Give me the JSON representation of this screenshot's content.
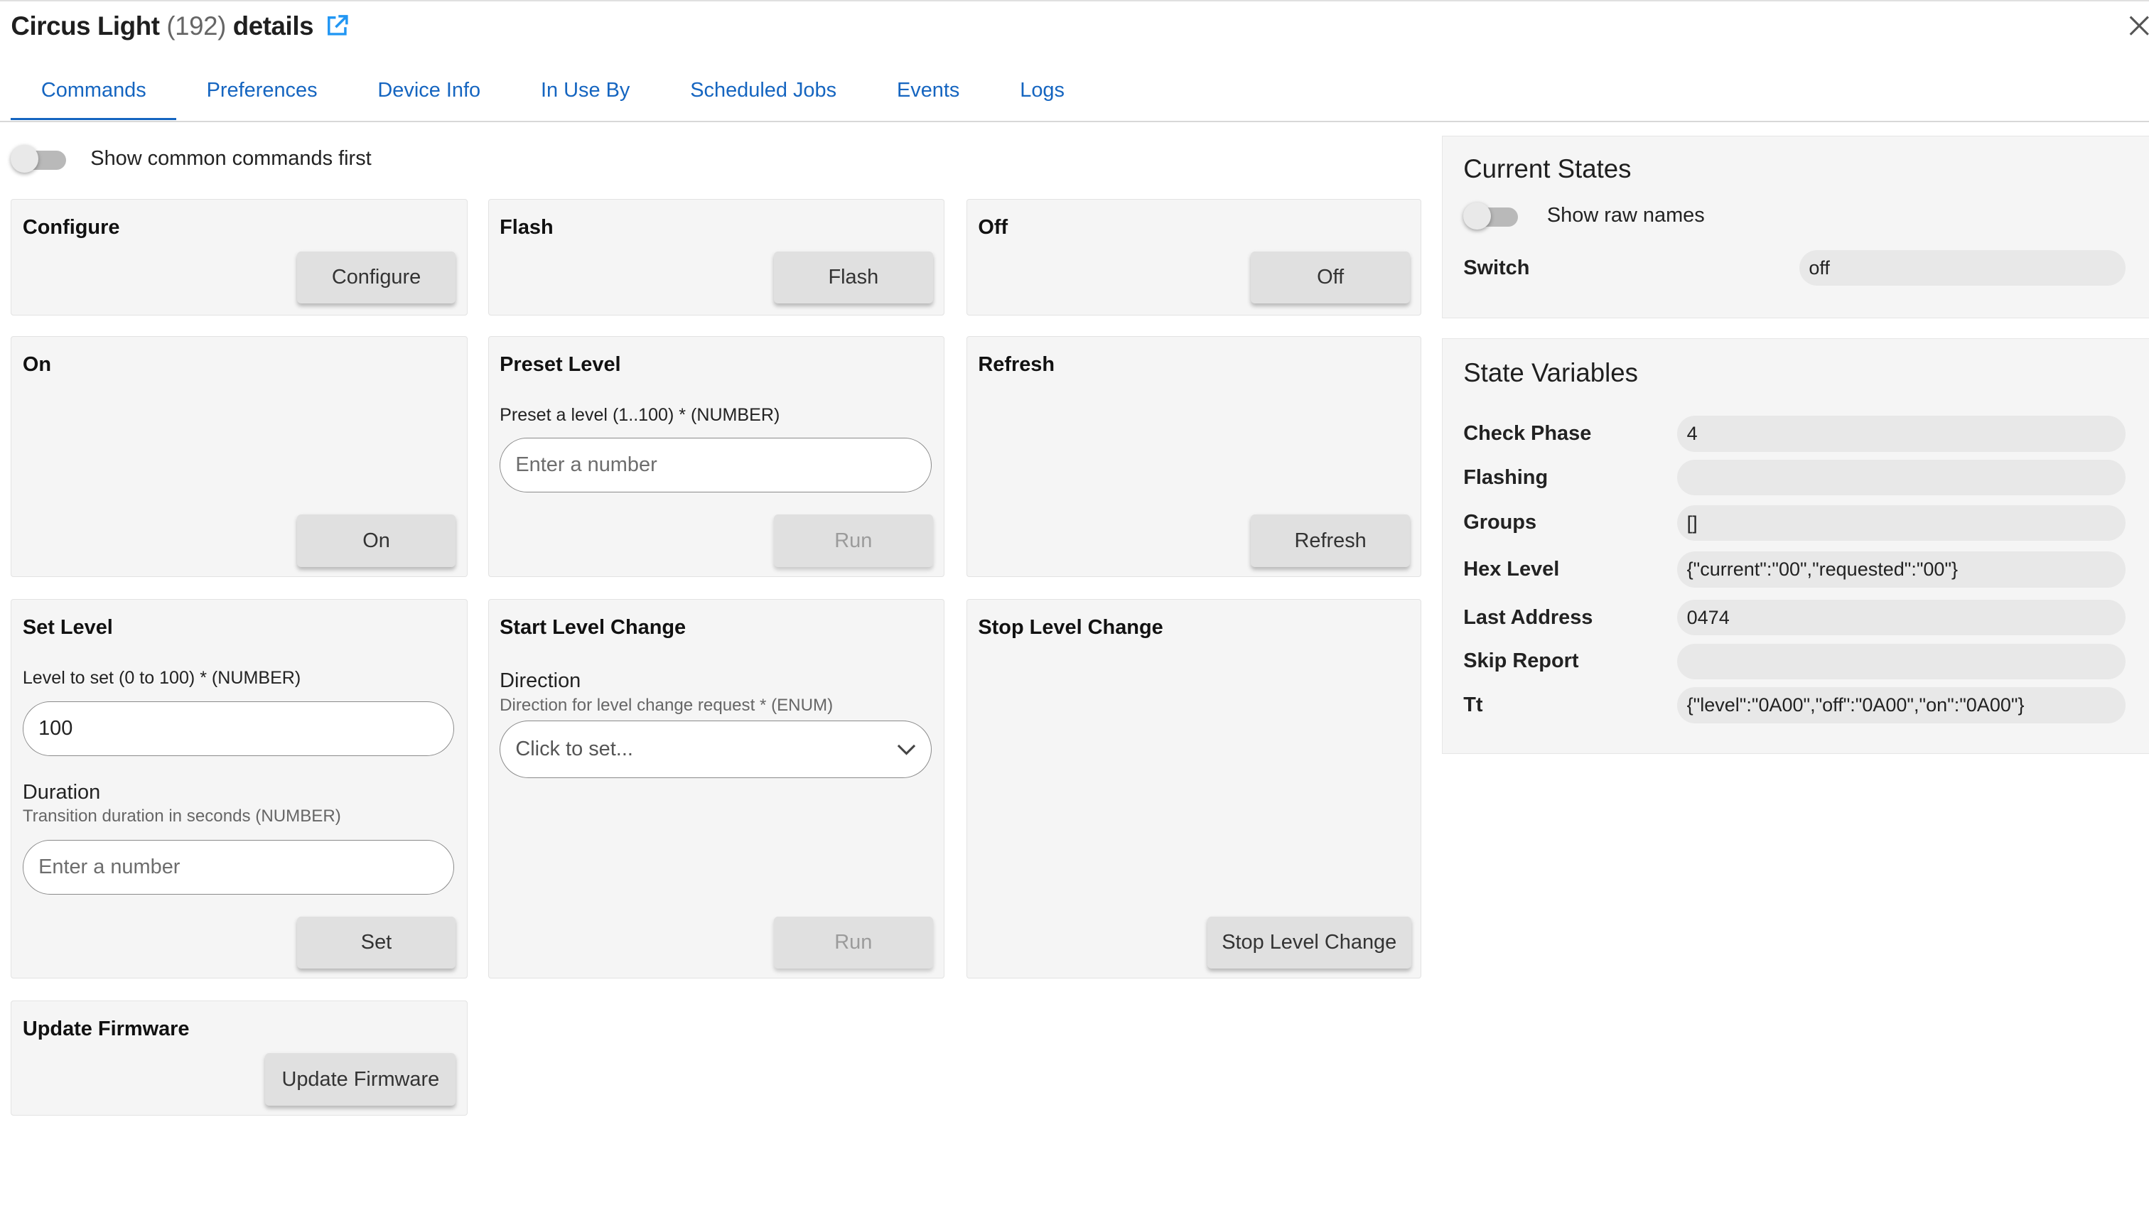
{
  "header": {
    "title_name": "Circus Light",
    "title_count": "(192)",
    "title_suffix": "details",
    "external_link_icon": "external-link-icon",
    "close_icon": "close-icon"
  },
  "tabs": [
    {
      "label": "Commands",
      "active": true
    },
    {
      "label": "Preferences"
    },
    {
      "label": "Device Info"
    },
    {
      "label": "In Use By"
    },
    {
      "label": "Scheduled Jobs"
    },
    {
      "label": "Events"
    },
    {
      "label": "Logs"
    }
  ],
  "commands": {
    "show_common_label": "Show common commands first",
    "configure": {
      "title": "Configure",
      "button": "Configure"
    },
    "flash": {
      "title": "Flash",
      "button": "Flash"
    },
    "off": {
      "title": "Off",
      "button": "Off"
    },
    "on": {
      "title": "On",
      "button": "On"
    },
    "preset_level": {
      "title": "Preset Level",
      "param_label": "Preset a level (1..100) * (NUMBER)",
      "placeholder": "Enter a number",
      "button": "Run"
    },
    "refresh": {
      "title": "Refresh",
      "button": "Refresh"
    },
    "set_level": {
      "title": "Set Level",
      "level_label": "Level to set (0 to 100) * (NUMBER)",
      "level_value": "100",
      "duration_name": "Duration",
      "duration_help": "Transition duration in seconds (NUMBER)",
      "duration_placeholder": "Enter a number",
      "button": "Set"
    },
    "start_level_change": {
      "title": "Start Level Change",
      "direction_name": "Direction",
      "direction_help": "Direction for level change request * (ENUM)",
      "direction_value": "Click to set...",
      "button": "Run"
    },
    "stop_level_change": {
      "title": "Stop Level Change",
      "button": "Stop Level Change"
    },
    "update_firmware": {
      "title": "Update Firmware",
      "button": "Update Firmware"
    }
  },
  "current_states": {
    "title": "Current States",
    "raw_names_label": "Show raw names",
    "rows": [
      {
        "name": "Switch",
        "value": "off"
      }
    ]
  },
  "state_variables": {
    "title": "State Variables",
    "rows": [
      {
        "name": "Check Phase",
        "value": "4"
      },
      {
        "name": "Flashing",
        "value": ""
      },
      {
        "name": "Groups",
        "value": "[]"
      },
      {
        "name": "Hex Level",
        "value": "{\"current\":\"00\",\"requested\":\"00\"}"
      },
      {
        "name": "Last Address",
        "value": "0474"
      },
      {
        "name": "Skip Report",
        "value": ""
      },
      {
        "name": "Tt",
        "value": "{\"level\":\"0A00\",\"off\":\"0A00\",\"on\":\"0A00\"}"
      }
    ]
  }
}
